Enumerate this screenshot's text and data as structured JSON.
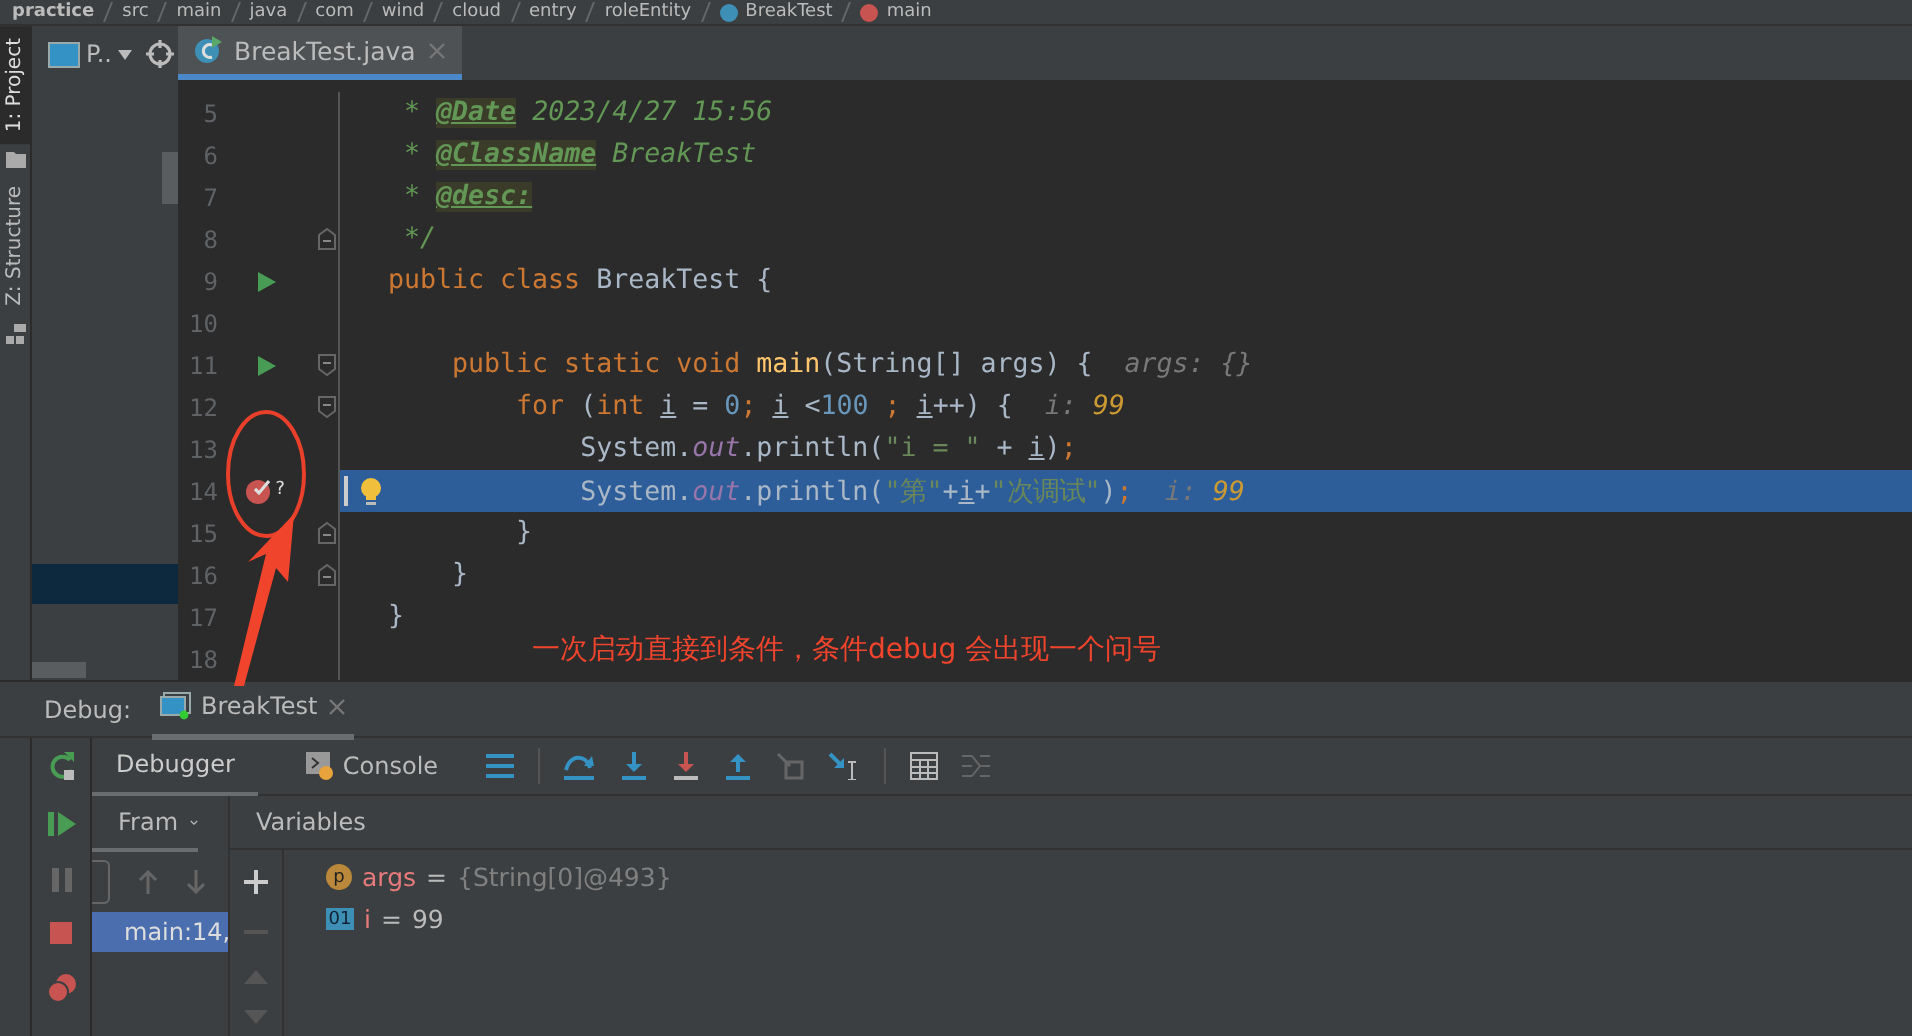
{
  "breadcrumbs": [
    {
      "label": "practice",
      "kind": "project"
    },
    {
      "label": "src",
      "kind": "folder"
    },
    {
      "label": "main",
      "kind": "folder"
    },
    {
      "label": "java",
      "kind": "folder"
    },
    {
      "label": "com",
      "kind": "folder"
    },
    {
      "label": "wind",
      "kind": "folder"
    },
    {
      "label": "cloud",
      "kind": "folder"
    },
    {
      "label": "entry",
      "kind": "folder"
    },
    {
      "label": "roleEntity",
      "kind": "folder"
    },
    {
      "label": "BreakTest",
      "kind": "class"
    },
    {
      "label": "main",
      "kind": "method"
    }
  ],
  "tool_stripe": [
    {
      "label": "1: Project",
      "selected": true
    },
    {
      "label": "Z: Structure",
      "selected": false
    }
  ],
  "project_panel": {
    "title": "P.."
  },
  "editor": {
    "tabs": [
      {
        "label": "BreakTest.java",
        "selected": true
      }
    ],
    "lines": [
      {
        "number": "5",
        "tokens": [
          {
            "kind": "doc",
            "text": " * "
          },
          {
            "kind": "tag",
            "text": "@Date"
          },
          {
            "kind": "doc",
            "text": " 2023/4/27 15:56"
          }
        ]
      },
      {
        "number": "6",
        "tokens": [
          {
            "kind": "doc",
            "text": " * "
          },
          {
            "kind": "tag",
            "text": "@ClassName"
          },
          {
            "kind": "doc",
            "text": " BreakTest"
          }
        ]
      },
      {
        "number": "7",
        "tokens": [
          {
            "kind": "doc",
            "text": " * "
          },
          {
            "kind": "tag",
            "text": "@desc:"
          }
        ]
      },
      {
        "number": "8",
        "fold": {
          "kind": "end"
        },
        "tokens": [
          {
            "kind": "doc",
            "text": " */"
          }
        ]
      },
      {
        "number": "9",
        "gutter": {
          "kind": "run"
        },
        "tokens": [
          {
            "kind": "kw",
            "text": "public class "
          },
          {
            "kind": "plain",
            "text": "BreakTest {"
          }
        ]
      },
      {
        "number": "10"
      },
      {
        "number": "11",
        "gutter": {
          "kind": "run"
        },
        "fold": {
          "kind": "start"
        },
        "tokens": [
          {
            "kind": "kw",
            "text": "    public static void "
          },
          {
            "kind": "fn",
            "text": "main"
          },
          {
            "kind": "plain",
            "text": "(String[] args) {"
          },
          {
            "kind": "hint",
            "text": "  args: {}"
          }
        ]
      },
      {
        "number": "12",
        "fold": {
          "kind": "start"
        },
        "tokens": [
          {
            "kind": "kw",
            "text": "        for "
          },
          {
            "kind": "plain",
            "text": "("
          },
          {
            "kind": "kw",
            "text": "int "
          },
          {
            "kind": "local",
            "text": "i"
          },
          {
            "kind": "plain",
            "text": " = "
          },
          {
            "kind": "num",
            "text": "0"
          },
          {
            "kind": "kw",
            "text": "; "
          },
          {
            "kind": "local",
            "text": "i"
          },
          {
            "kind": "plain",
            "text": " <"
          },
          {
            "kind": "num",
            "text": "100"
          },
          {
            "kind": "kw",
            "text": " ; "
          },
          {
            "kind": "local",
            "text": "i"
          },
          {
            "kind": "plain",
            "text": "++) {"
          },
          {
            "kind": "hint",
            "text": "  i: "
          },
          {
            "kind": "hintval",
            "text": "99"
          }
        ]
      },
      {
        "number": "13",
        "tokens": [
          {
            "kind": "plain",
            "text": "            System."
          },
          {
            "kind": "static",
            "text": "out"
          },
          {
            "kind": "plain",
            "text": ".println("
          },
          {
            "kind": "str",
            "text": "\"i = \""
          },
          {
            "kind": "plain",
            "text": " + "
          },
          {
            "kind": "local",
            "text": "i"
          },
          {
            "kind": "plain",
            "text": ")"
          },
          {
            "kind": "kw",
            "text": ";"
          }
        ]
      },
      {
        "number": "14",
        "current": true,
        "gutter": {
          "kind": "breakpoint",
          "mark": "?"
        },
        "bulb": true,
        "tokens": [
          {
            "kind": "plain",
            "text": "            System."
          },
          {
            "kind": "static",
            "text": "out"
          },
          {
            "kind": "plain",
            "text": ".println("
          },
          {
            "kind": "str",
            "text": "\"第\""
          },
          {
            "kind": "plain",
            "text": "+"
          },
          {
            "kind": "local",
            "text": "i"
          },
          {
            "kind": "plain",
            "text": "+"
          },
          {
            "kind": "str",
            "text": "\"次调试\""
          },
          {
            "kind": "plain",
            "text": ")"
          },
          {
            "kind": "kw",
            "text": ";"
          },
          {
            "kind": "hint",
            "text": "  i: "
          },
          {
            "kind": "hintval",
            "text": "99"
          }
        ]
      },
      {
        "number": "15",
        "fold": {
          "kind": "end"
        },
        "tokens": [
          {
            "kind": "plain",
            "text": "        }"
          }
        ]
      },
      {
        "number": "16",
        "fold": {
          "kind": "end"
        },
        "tokens": [
          {
            "kind": "plain",
            "text": "    }"
          }
        ]
      },
      {
        "number": "17",
        "tokens": [
          {
            "kind": "plain",
            "text": "}"
          }
        ]
      },
      {
        "number": "18"
      }
    ]
  },
  "annotation": {
    "text": "一次启动直接到条件，条件debug 会出现一个问号"
  },
  "debug": {
    "label": "Debug:",
    "sessions": [
      {
        "label": "BreakTest",
        "selected": true
      }
    ],
    "tabs": [
      {
        "label": "Debugger",
        "selected": true
      },
      {
        "label": "Console",
        "selected": false
      }
    ],
    "frames": {
      "title": "Fram",
      "items": [
        {
          "label": "main:14,",
          "selected": true
        }
      ]
    },
    "variables": {
      "title": "Variables",
      "items": [
        {
          "kind": "object",
          "badge": "p",
          "name": "args",
          "sign": "=",
          "value": "{String[0]@493}"
        },
        {
          "kind": "primitive",
          "badge": "01",
          "name": "i",
          "sign": "=",
          "value": "99"
        }
      ]
    }
  }
}
